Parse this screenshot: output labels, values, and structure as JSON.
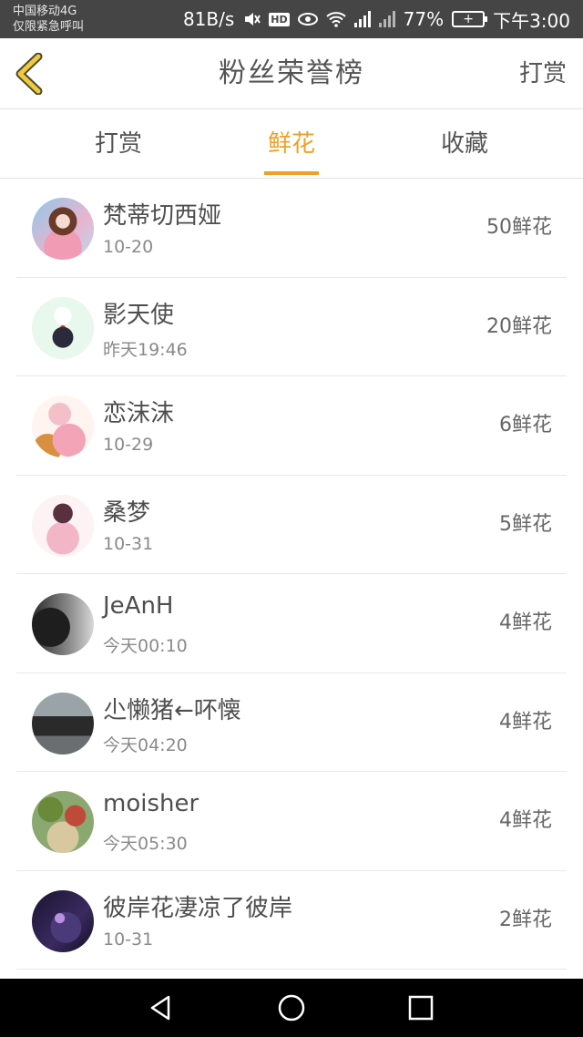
{
  "status_bar": {
    "carrier": "中国移动4G",
    "emergency": "仅限紧急呼叫",
    "speed": "81B/s",
    "hd": "HD",
    "battery_percent": "77%",
    "time": "下午3:00"
  },
  "header": {
    "title": "粉丝荣誉榜",
    "action_label": "打赏"
  },
  "tabs": [
    {
      "label": "打赏",
      "active": false
    },
    {
      "label": "鲜花",
      "active": true
    },
    {
      "label": "收藏",
      "active": false
    }
  ],
  "fans": [
    {
      "name": "梵蒂切西娅",
      "time": "10-20",
      "count": "50鲜花"
    },
    {
      "name": "影天使",
      "time": "昨天19:46",
      "count": "20鲜花"
    },
    {
      "name": "恋沫沫",
      "time": "10-29",
      "count": "6鲜花"
    },
    {
      "name": "桑梦",
      "time": "10-31",
      "count": "5鲜花"
    },
    {
      "name": "JeAnH",
      "time": "今天00:10",
      "count": "4鲜花"
    },
    {
      "name": "尐懒猪←吥懐",
      "time": "今天04:20",
      "count": "4鲜花"
    },
    {
      "name": "moisher",
      "time": "今天05:30",
      "count": "4鲜花"
    },
    {
      "name": "彼岸花凄凉了彼岸",
      "time": "10-31",
      "count": "2鲜花"
    }
  ],
  "colors": {
    "accent": "#f0a023",
    "status_bar_bg": "#454545",
    "nav_bar_bg": "#000000"
  }
}
